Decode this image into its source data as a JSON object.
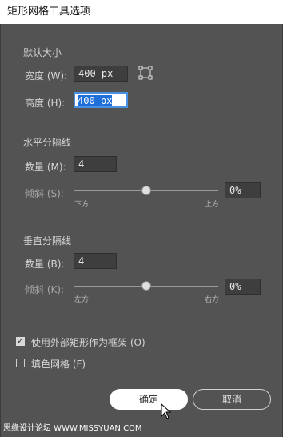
{
  "window": {
    "title": "矩形网格工具选项"
  },
  "size": {
    "section_label": "默认大小",
    "width_label": "宽度 (W):",
    "width_value": "400 px",
    "height_label": "高度 (H):",
    "height_value": "400 px"
  },
  "horizontal": {
    "section_label": "水平分隔线",
    "count_label": "数量 (M):",
    "count_value": "4",
    "skew_label": "倾斜 (S):",
    "skew_value": "0%",
    "skew_fraction": 0.5,
    "left_label": "下方",
    "right_label": "上方"
  },
  "vertical": {
    "section_label": "垂直分隔线",
    "count_label": "数量 (B):",
    "count_value": "4",
    "skew_label": "倾斜 (K):",
    "skew_value": "0%",
    "skew_fraction": 0.5,
    "left_label": "左方",
    "right_label": "右方"
  },
  "options": {
    "use_outer_rect_label": "使用外部矩形作为框架 (O)",
    "use_outer_rect_checked": true,
    "fill_grid_label": "填色网格 (F)",
    "fill_grid_checked": false
  },
  "buttons": {
    "ok_label": "确定",
    "cancel_label": "取消"
  },
  "watermark": "思缘设计论坛 WWW.MISSYUAN.COM"
}
